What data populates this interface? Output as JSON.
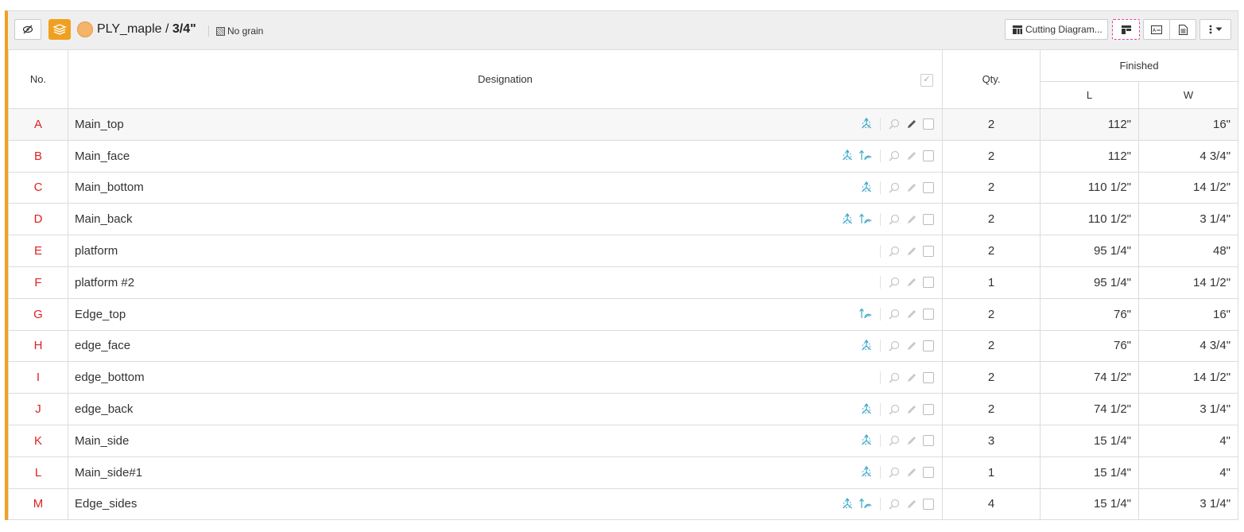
{
  "toolbar": {
    "material_name": "PLY_maple",
    "material_sep": " / ",
    "material_thickness": "3/4\"",
    "grain_label": "No grain",
    "cutting_diagram_label": "Cutting Diagram..."
  },
  "colors": {
    "accent": "#f0a020",
    "part_number": "#e02020",
    "icon_blue": "#40a8c8",
    "highlight_border": "#e0409a"
  },
  "table": {
    "headers": {
      "no": "No.",
      "designation": "Designation",
      "qty": "Qty.",
      "finished": "Finished",
      "length": "L",
      "width": "W"
    },
    "rows": [
      {
        "no": "A",
        "name": "Main_top",
        "qty": "2",
        "l": "112\"",
        "w": "16\"",
        "axes": true,
        "flip": false,
        "active": true
      },
      {
        "no": "B",
        "name": "Main_face",
        "qty": "2",
        "l": "112\"",
        "w": "4 3/4\"",
        "axes": true,
        "flip": true,
        "active": false
      },
      {
        "no": "C",
        "name": "Main_bottom",
        "qty": "2",
        "l": "110 1/2\"",
        "w": "14 1/2\"",
        "axes": true,
        "flip": false,
        "active": false
      },
      {
        "no": "D",
        "name": "Main_back",
        "qty": "2",
        "l": "110 1/2\"",
        "w": "3 1/4\"",
        "axes": true,
        "flip": true,
        "active": false
      },
      {
        "no": "E",
        "name": "platform",
        "qty": "2",
        "l": "95 1/4\"",
        "w": "48\"",
        "axes": false,
        "flip": false,
        "active": false
      },
      {
        "no": "F",
        "name": "platform #2",
        "qty": "1",
        "l": "95 1/4\"",
        "w": "14 1/2\"",
        "axes": false,
        "flip": false,
        "active": false
      },
      {
        "no": "G",
        "name": "Edge_top",
        "qty": "2",
        "l": "76\"",
        "w": "16\"",
        "axes": false,
        "flip": true,
        "active": false
      },
      {
        "no": "H",
        "name": "edge_face",
        "qty": "2",
        "l": "76\"",
        "w": "4 3/4\"",
        "axes": true,
        "flip": false,
        "active": false
      },
      {
        "no": "I",
        "name": "edge_bottom",
        "qty": "2",
        "l": "74 1/2\"",
        "w": "14 1/2\"",
        "axes": false,
        "flip": false,
        "active": false
      },
      {
        "no": "J",
        "name": "edge_back",
        "qty": "2",
        "l": "74 1/2\"",
        "w": "3 1/4\"",
        "axes": true,
        "flip": false,
        "active": false
      },
      {
        "no": "K",
        "name": "Main_side",
        "qty": "3",
        "l": "15 1/4\"",
        "w": "4\"",
        "axes": true,
        "flip": false,
        "active": false
      },
      {
        "no": "L",
        "name": "Main_side#1",
        "qty": "1",
        "l": "15 1/4\"",
        "w": "4\"",
        "axes": true,
        "flip": false,
        "active": false
      },
      {
        "no": "M",
        "name": "Edge_sides",
        "qty": "4",
        "l": "15 1/4\"",
        "w": "3 1/4\"",
        "axes": true,
        "flip": true,
        "active": false
      }
    ]
  }
}
